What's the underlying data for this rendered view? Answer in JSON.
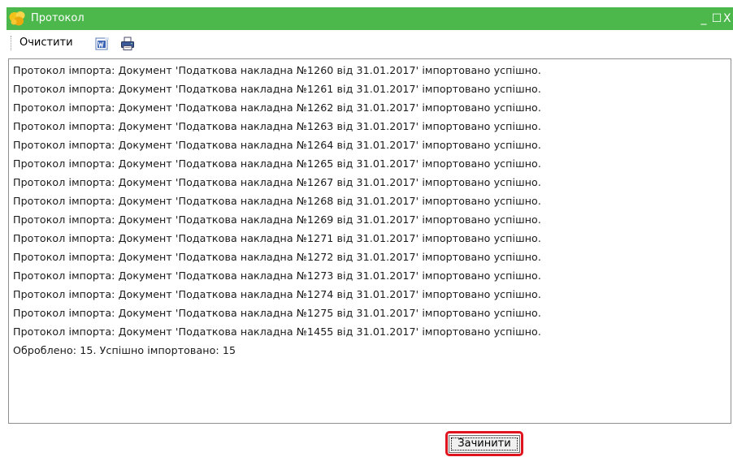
{
  "window": {
    "title": "Протокол",
    "controls": {
      "minimize": "_",
      "maximize": "☐",
      "close": "X"
    }
  },
  "toolbar": {
    "clear_label": "Очистити",
    "icons": [
      "word-export-icon",
      "print-icon"
    ]
  },
  "log": {
    "lines": [
      "Протокол імпорта: Документ 'Податкова накладна  №1260 від 31.01.2017' імпортовано успішно.",
      "Протокол імпорта: Документ 'Податкова накладна  №1261 від 31.01.2017' імпортовано успішно.",
      "Протокол імпорта: Документ 'Податкова накладна  №1262 від 31.01.2017' імпортовано успішно.",
      "Протокол імпорта: Документ 'Податкова накладна  №1263 від 31.01.2017' імпортовано успішно.",
      "Протокол імпорта: Документ 'Податкова накладна  №1264 від 31.01.2017' імпортовано успішно.",
      "Протокол імпорта: Документ 'Податкова накладна  №1265 від 31.01.2017' імпортовано успішно.",
      "Протокол імпорта: Документ 'Податкова накладна  №1267 від 31.01.2017' імпортовано успішно.",
      "Протокол імпорта: Документ 'Податкова накладна  №1268 від 31.01.2017' імпортовано успішно.",
      "Протокол імпорта: Документ 'Податкова накладна  №1269 від 31.01.2017' імпортовано успішно.",
      "Протокол імпорта: Документ 'Податкова накладна  №1271 від 31.01.2017' імпортовано успішно.",
      "Протокол імпорта: Документ 'Податкова накладна  №1272 від 31.01.2017' імпортовано успішно.",
      "Протокол імпорта: Документ 'Податкова накладна  №1273 від 31.01.2017' імпортовано успішно.",
      "Протокол імпорта: Документ 'Податкова накладна  №1274 від 31.01.2017' імпортовано успішно.",
      "Протокол імпорта: Документ 'Податкова накладна  №1275 від 31.01.2017' імпортовано успішно.",
      "Протокол імпорта: Документ 'Податкова накладна  №1455 від 31.01.2017' імпортовано успішно.",
      "Оброблено: 15. Успішно імпортовано: 15"
    ]
  },
  "footer": {
    "close_button_label": "Зачинити"
  },
  "colors": {
    "titlebar": "#4cb84c",
    "highlight": "#e0141e"
  }
}
